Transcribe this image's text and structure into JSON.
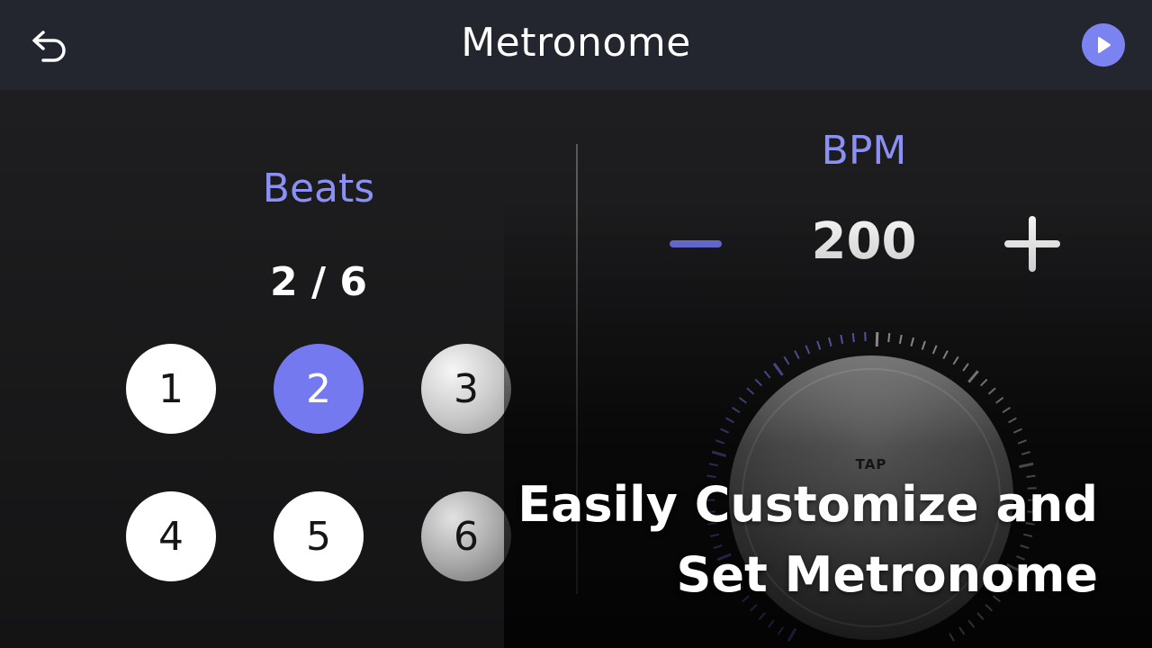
{
  "header": {
    "title": "Metronome",
    "back_icon": "back-arrow-icon",
    "play_icon": "play-icon",
    "play_color": "#7b83f0"
  },
  "beats": {
    "label": "Beats",
    "count_text": "2 / 6",
    "items": [
      {
        "label": "1",
        "state": "default"
      },
      {
        "label": "2",
        "state": "active"
      },
      {
        "label": "3",
        "state": "muted"
      },
      {
        "label": "4",
        "state": "default"
      },
      {
        "label": "5",
        "state": "default"
      },
      {
        "label": "6",
        "state": "muted"
      }
    ],
    "active_color": "#7479ef"
  },
  "bpm": {
    "label": "BPM",
    "value": "200",
    "decrease_icon": "minus-icon",
    "increase_icon": "plus-icon",
    "tap_label": "TAP",
    "accent_color": "#7b83f0"
  },
  "caption": {
    "line1": "Easily Customize and",
    "line2": "Set Metronome"
  }
}
